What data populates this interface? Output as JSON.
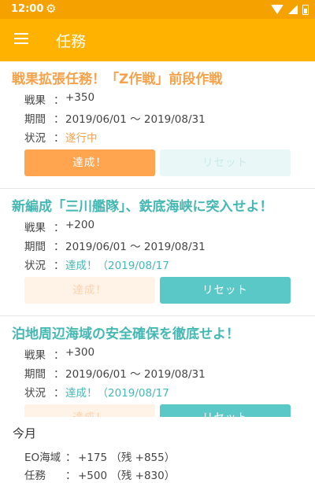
{
  "status_bar": {
    "time": "12:00",
    "settings_icon": "gear-icon",
    "icons": [
      "wifi-icon",
      "signal-icon",
      "battery-icon"
    ]
  },
  "app_bar": {
    "title": "任務",
    "menu_icon": "hamburger-menu-icon"
  },
  "colors": {
    "accent_orange": "#ffa54f",
    "accent_teal": "#5bc8c8",
    "title_orange": "#f5a24a",
    "title_teal": "#45b8b4",
    "app_bar": "#ffb300",
    "status_bar": "#f5a200"
  },
  "labels": {
    "result": "戦果",
    "period": "期間",
    "status": "状況",
    "colon": "："
  },
  "missions": [
    {
      "title": "戦果拡張任務！「Z作戦」前段作戦",
      "result": "+350",
      "period": "2019/06/01 〜 2019/08/31",
      "status": "遂行中",
      "complete_button": "達成！",
      "reset_button": "リセット",
      "complete_enabled": true,
      "reset_enabled": false
    },
    {
      "title": "新編成「三川艦隊」、鉄底海峡に突入せよ！",
      "result": "+200",
      "period": "2019/06/01 〜 2019/08/31",
      "status": "達成！（2019/08/17",
      "complete_button": "達成！",
      "reset_button": "リセット",
      "complete_enabled": false,
      "reset_enabled": true
    },
    {
      "title": "泊地周辺海域の安全確保を徹底せよ！",
      "result": "+300",
      "period": "2019/06/01 〜 2019/08/31",
      "status": "達成！（2019/08/17",
      "complete_button": "達成！",
      "reset_button": "リセット",
      "complete_enabled": false,
      "reset_enabled": true
    }
  ],
  "summary": {
    "title": "今月",
    "rows": [
      {
        "label": "EO海域",
        "value": "+175 （残 +855）"
      },
      {
        "label": "任務",
        "value": "+500 （残 +830）"
      }
    ]
  }
}
